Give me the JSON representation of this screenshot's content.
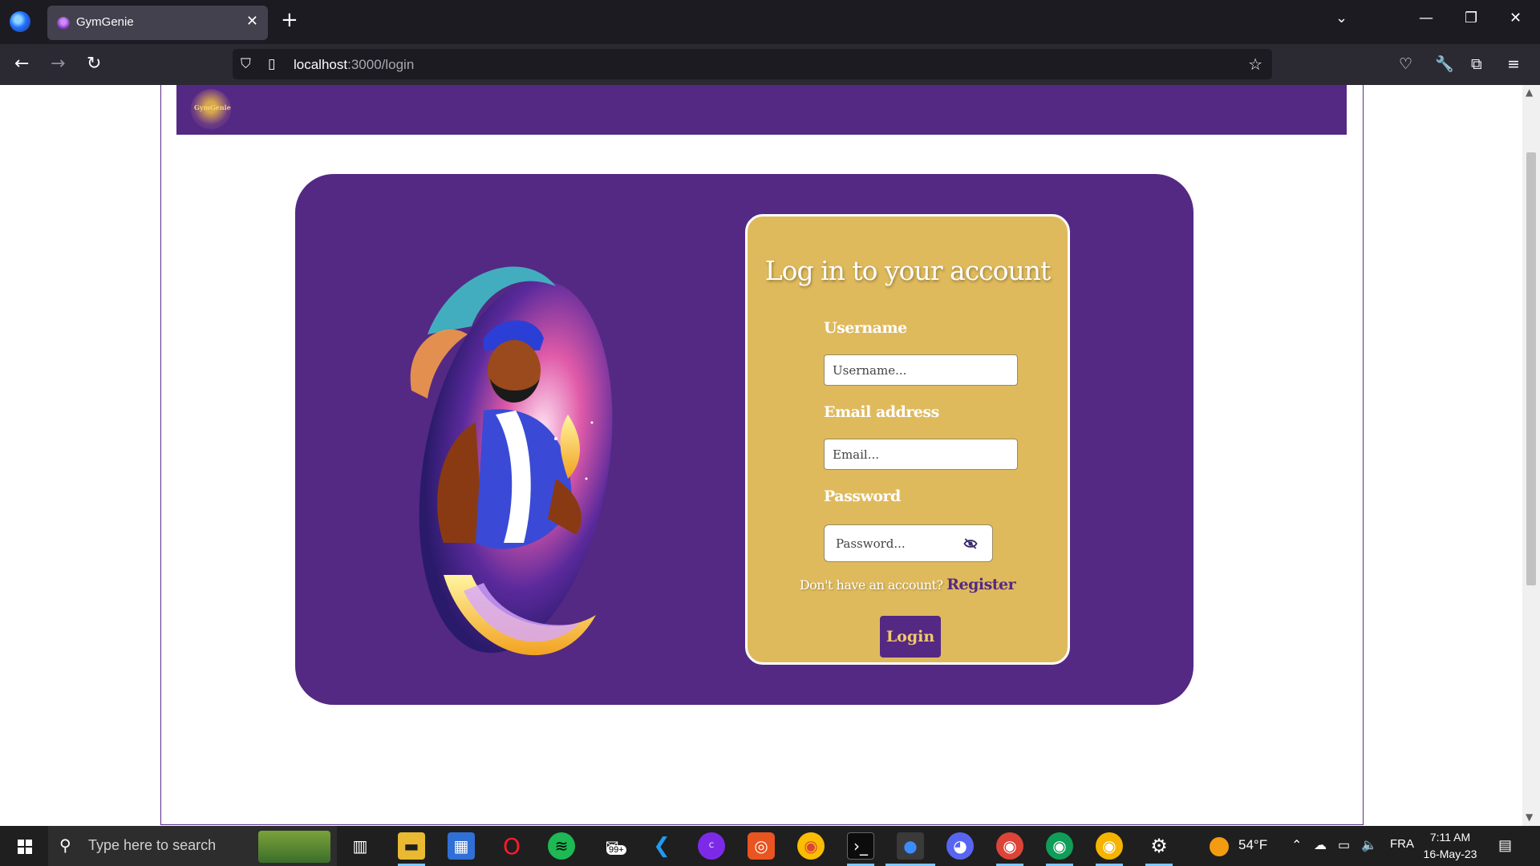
{
  "browser": {
    "tab_title": "GymGenie",
    "tab_close": "✕",
    "new_tab": "+",
    "url_host": "localhost",
    "url_rest": ":3000/login"
  },
  "site": {
    "logo_text": "GymGenie"
  },
  "login": {
    "title": "Log in to your account",
    "username_label": "Username",
    "username_placeholder": "Username...",
    "email_label": "Email address",
    "email_placeholder": "Email...",
    "password_label": "Password",
    "password_placeholder": "Password...",
    "no_account_text": "Don't have an account?",
    "register_link": "Register",
    "login_button": "Login"
  },
  "taskbar": {
    "search_placeholder": "Type here to search",
    "mail_badge": "99+",
    "weather": "54°F",
    "language": "FRA",
    "time": "7:11 AM",
    "date": "16-May-23"
  },
  "colors": {
    "brand_purple": "#542983",
    "card_gold": "#dfba5c"
  }
}
